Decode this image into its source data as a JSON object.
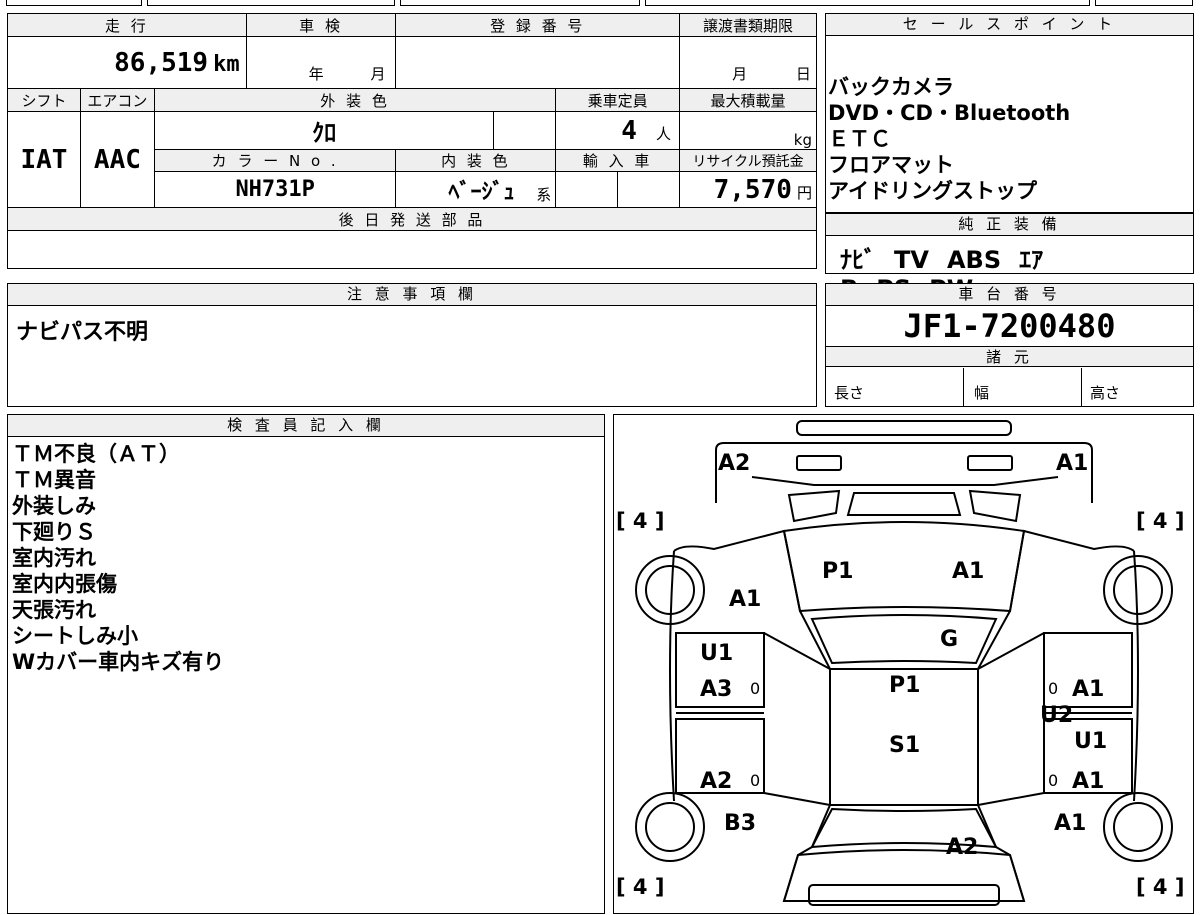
{
  "vehicle": {
    "mileage_label": "走 行",
    "mileage": "86,519",
    "mileage_unit": "km",
    "inspection_label": "車 検",
    "year_label": "年",
    "month_label": "月",
    "registration_label": "登 録 番 号",
    "transfer_deadline_label": "譲渡書類期限",
    "transfer_month": "月",
    "transfer_day": "日",
    "shift_label": "シフト",
    "shift": "IAT",
    "ac_label": "エアコン",
    "ac": "AAC",
    "exterior_color_label": "外 装 色",
    "exterior_color": "ｸﾛ",
    "capacity_label": "乗車定員",
    "capacity": "4",
    "capacity_unit": "人",
    "max_load_label": "最大積載量",
    "max_load_unit": "kg",
    "color_no_label": "カ ラ ー N o .",
    "color_no": "NH731P",
    "interior_color_label": "内 装 色",
    "interior_color": "ﾍﾞｰｼﾞｭ",
    "interior_suffix": "系",
    "import_label": "輸 入 車",
    "recycle_label": "リサイクル預託金",
    "recycle_fee": "7,570",
    "recycle_unit": "円",
    "later_parts_label": "後 日 発 送 部 品"
  },
  "sales_points": {
    "label": "セ ー ル ス ポ イ ン ト",
    "items": [
      "バックカメラ",
      "DVD・CD・Bluetooth",
      "ＥＴＣ",
      "フロアマット",
      "アイドリングストップ"
    ]
  },
  "equipment": {
    "label": "純 正 装 備",
    "items": [
      "ﾅﾋﾞ",
      "TV",
      "ABS",
      "ｴｱB",
      "PS",
      "PW"
    ]
  },
  "notes": {
    "label": "注 意 事 項 欄",
    "text": "ナビパス不明"
  },
  "chassis": {
    "label": "車 台 番 号",
    "number": "JF1-7200480"
  },
  "specs": {
    "label": "諸 元",
    "length_label": "長さ",
    "width_label": "幅",
    "height_label": "高さ"
  },
  "inspector": {
    "label": "検 査 員 記 入 欄",
    "items": [
      "ＴＭ不良（ＡＴ）",
      "ＴＭ異音",
      "外装しみ",
      "下廻りＳ",
      "室内汚れ",
      "室内内張傷",
      "天張汚れ",
      "シートしみ小",
      "Wカバー車内キズ有り"
    ]
  },
  "diagram": {
    "front_left": "A2",
    "front_right": "A1",
    "bracket_tl": "[ 4 ]",
    "bracket_tr": "[ 4 ]",
    "bracket_bl": "[ 4 ]",
    "bracket_br": "[ 4 ]",
    "hood_left": "P1",
    "hood_right": "A1",
    "fender_left": "A1",
    "windshield": "G",
    "roof_top": "P1",
    "roof_bottom": "S1",
    "left_door_top": "U1",
    "left_door_mid": "A3",
    "left_rear": "A2",
    "left_rear_wheel": "B3",
    "right_door_top": "A1",
    "right_door_mid": "U2",
    "right_door_mid2": "U1",
    "right_rear": "A1",
    "right_rear_wheel": "A1",
    "rear_bottom": "A2",
    "zero_marks": [
      "0",
      "0",
      "0",
      "0"
    ]
  }
}
